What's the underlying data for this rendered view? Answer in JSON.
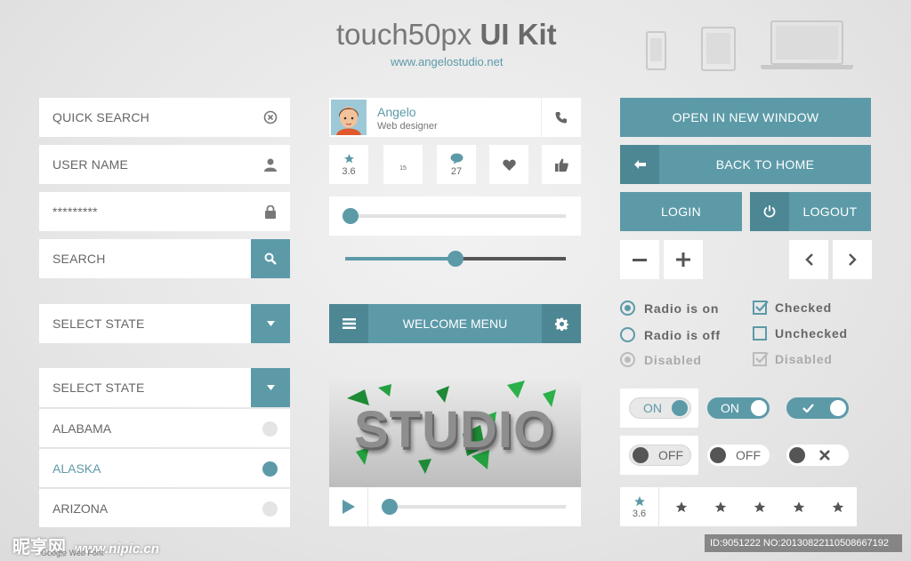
{
  "header": {
    "title_light": "touch50px",
    "title_bold": "UI Kit",
    "url": "www.angelostudio.net"
  },
  "devices": [
    "phone-icon",
    "tablet-icon",
    "laptop-icon"
  ],
  "left": {
    "quick_search": "QUICK SEARCH",
    "user_name": "USER NAME",
    "password": "*********",
    "search": "SEARCH",
    "select_state": "SELECT STATE",
    "dropdown": {
      "header": "SELECT STATE",
      "items": [
        {
          "label": "ALABAMA",
          "selected": false
        },
        {
          "label": "ALASKA",
          "selected": true
        },
        {
          "label": "ARIZONA",
          "selected": false
        }
      ]
    }
  },
  "middle": {
    "profile": {
      "name": "Angelo",
      "role": "Web designer"
    },
    "tiles": {
      "rating": "3.6",
      "calendar_day": "15",
      "comments": "27"
    },
    "slider1_value": 0.0,
    "slider2_value": 0.5,
    "menu_label": "WELCOME MENU",
    "video_text": "STUDIO",
    "video_progress": 0.0
  },
  "right": {
    "open_new_window": "OPEN IN NEW WINDOW",
    "back_to_home": "BACK TO HOME",
    "login": "LOGIN",
    "logout": "LOGOUT",
    "radio_on": "Radio is on",
    "radio_off": "Radio is off",
    "radio_disabled": "Disabled",
    "checked": "Checked",
    "unchecked": "Unchecked",
    "check_disabled": "Disabled",
    "toggle_on": "ON",
    "toggle_off": "OFF",
    "rating_value": "3.6"
  },
  "watermark": {
    "brand": "昵享网",
    "site": "www.nipic.cn",
    "id": "ID:9051222 NO:20130822110508667192"
  },
  "footer_hint": "Google Web Font",
  "colors": {
    "accent": "#5c9aa8",
    "accent_dark": "#4e8794",
    "text": "#666666"
  }
}
